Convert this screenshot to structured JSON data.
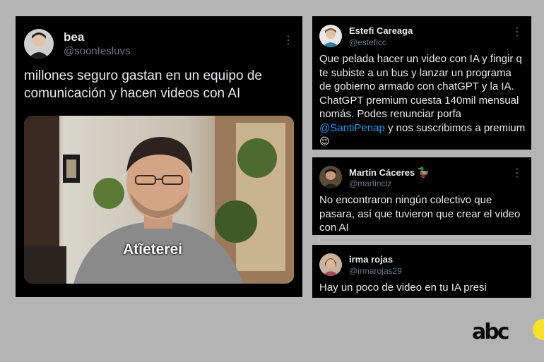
{
  "main_tweet": {
    "name": "bea",
    "handle": "@soonIesluvs",
    "text": "millones seguro gastan en un equipo de comunicación y hacen videos con AI",
    "video_caption": "Atĩeterei"
  },
  "estefi_tweet": {
    "name": "Estefi Careaga",
    "handle": "@esteficc",
    "text_before_mention": "Que pelada hacer un video con IA y fingir q te subiste a un bus y lanzar un programa de gobierno armado con chatGPT y la IA. ChatGPT premium cuesta 140mil mensual nomás. Podes renunciar porfa ",
    "mention": "@SantiPenap",
    "text_after_mention": " y nos suscribimos a premium",
    "emoji": "😌"
  },
  "martin_tweet": {
    "name": "Martín Cáceres",
    "name_emoji": "🦆",
    "handle": "@martinclz",
    "text": "No encontraron ningún colectivo que pasara, así que tuvieron que crear el video con AI"
  },
  "irma_tweet": {
    "name": "irma rojas",
    "handle": "@irmarojas29",
    "text": "Hay un poco de video en tu IA presi"
  },
  "more_icon_glyph": "⋮",
  "brand": {
    "logo_text": "abc",
    "accent_color": "#f7e12a"
  },
  "colors": {
    "background": "#b4b4b4",
    "card": "#000000",
    "mention": "#1d9bf0",
    "handle": "#71767b"
  }
}
